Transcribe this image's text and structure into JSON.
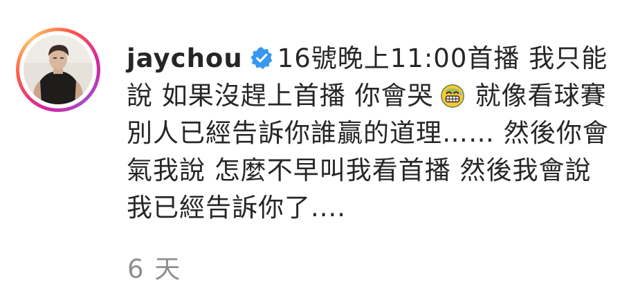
{
  "post": {
    "username": "jaychou",
    "caption_part1": "16號晚上11:00首播 我只能說 如果沒趕上首播 你會哭",
    "caption_part2": "就像看球賽別人已經告訴你誰贏的道理…… 然後你會氣我說 怎麼不早叫我看首播 然後我會說 我已經告訴你了....",
    "timestamp": "6 天",
    "verified_icon": "verified-badge-icon",
    "emoji_icon": "grinning-sweat-emoji-icon",
    "colors": {
      "text": "#262626",
      "timestamp": "#8e8e8e",
      "verified": "#3897f0"
    }
  }
}
